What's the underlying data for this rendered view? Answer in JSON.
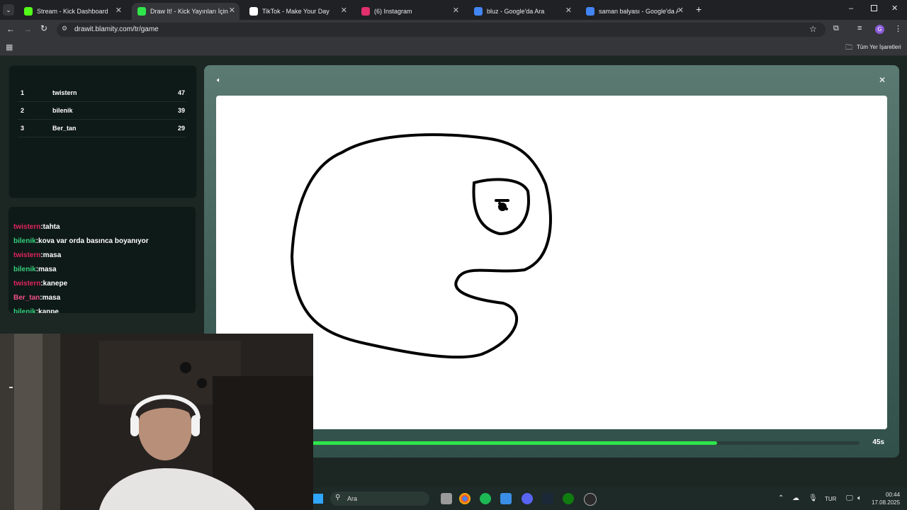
{
  "browser": {
    "tabs": [
      {
        "title": "Stream - Kick Dashboard",
        "icon": "kick-icon",
        "color": "#53fc18"
      },
      {
        "title": "Draw It! - Kick Yayınları İçin Çizi",
        "icon": "drawit-icon",
        "color": "#2ee54a"
      },
      {
        "title": "TikTok - Make Your Day",
        "icon": "tiktok-icon",
        "color": "#ffffff"
      },
      {
        "title": "(6) Instagram",
        "icon": "instagram-icon",
        "color": "#e1306c"
      },
      {
        "title": "bluz - Google'da Ara",
        "icon": "google-icon",
        "color": "#4285f4"
      },
      {
        "title": "saman balyası - Google'da Ara",
        "icon": "google-icon",
        "color": "#4285f4"
      }
    ],
    "url": "drawit.blamity.com/tr/game",
    "bookmarks_label": "Tüm Yer İşaretleri",
    "profile_initial": "G"
  },
  "leaderboard": [
    {
      "rank": "1",
      "name": "twistern",
      "score": "47"
    },
    {
      "rank": "2",
      "name": "bilenik",
      "score": "39"
    },
    {
      "rank": "3",
      "name": "Ber_tan",
      "score": "29"
    }
  ],
  "chat": [
    {
      "user": "twistern",
      "msg": ":tahta",
      "color": "#e0245e"
    },
    {
      "user": "bilenik",
      "msg": ":kova var orda basınca boyanıyor",
      "color": "#35d07f"
    },
    {
      "user": "twistern",
      "msg": ":masa",
      "color": "#e0245e"
    },
    {
      "user": "bilenik",
      "msg": ":masa",
      "color": "#35d07f"
    },
    {
      "user": "twistern",
      "msg": ":kanepe",
      "color": "#e0245e"
    },
    {
      "user": "Ber_tan",
      "msg": ":masa",
      "color": "#f0508a"
    },
    {
      "user": "bilenik",
      "msg": ":kanpe",
      "color": "#35d07f"
    }
  ],
  "game": {
    "timer": "45s",
    "progress": 0.74,
    "accent": "#2ee54a"
  },
  "taskbar": {
    "search_placeholder": "Ara",
    "language": "TUR",
    "time": "00:44",
    "date": "17.08.2025"
  }
}
